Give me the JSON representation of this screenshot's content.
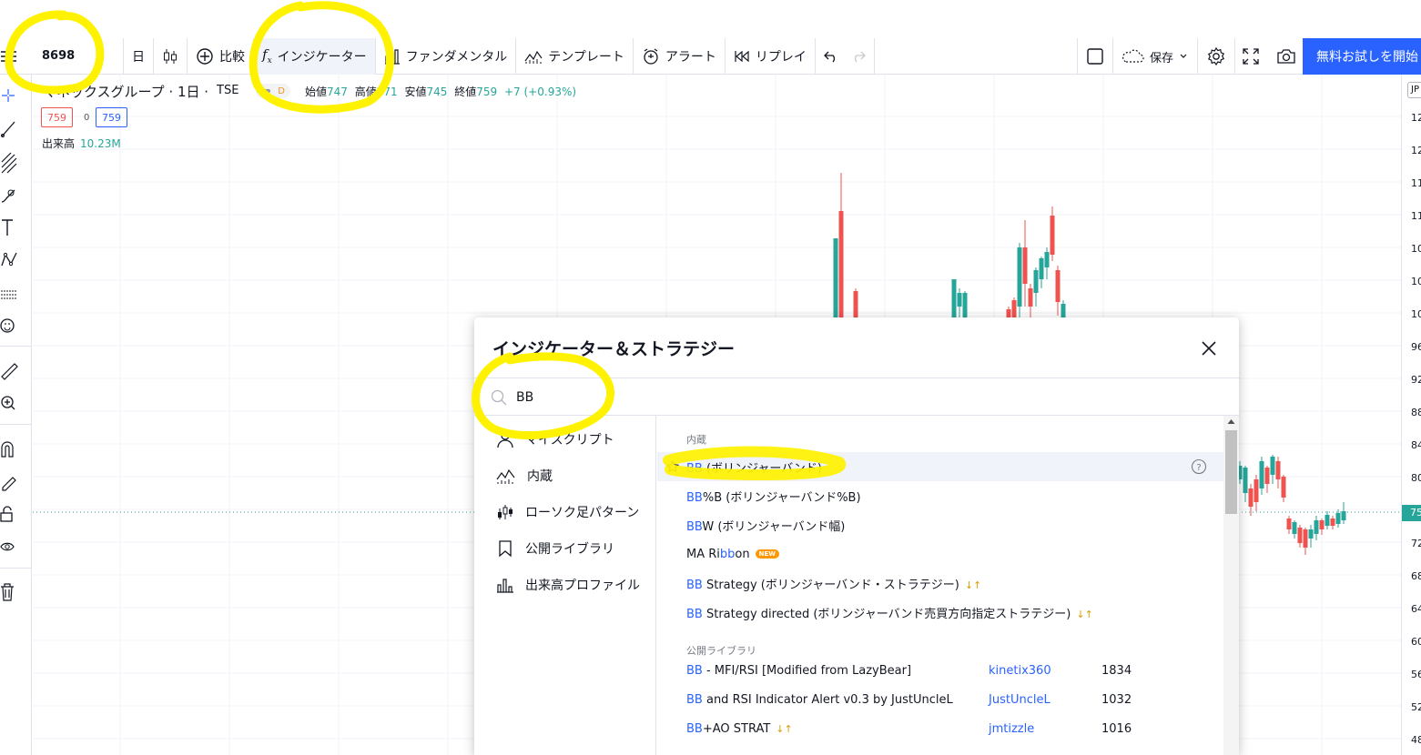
{
  "toolbar": {
    "symbol": "8698",
    "interval": "日",
    "compare_label": "比較",
    "indicators_label": "インジケーター",
    "fundamentals_label": "ファンダメンタル",
    "templates_label": "テンプレート",
    "alert_label": "アラート",
    "replay_label": "リプレイ",
    "save_label": "保存",
    "cta_label": "無料お試しを開始"
  },
  "legend": {
    "title": "マネックスグループ · 1日 ·",
    "exchange": "TSE",
    "d_badge": "D",
    "open_label": "始値",
    "open": "747",
    "high_label": "高値",
    "high": "771",
    "low_label": "安値",
    "low": "745",
    "close_label": "終値",
    "close": "759",
    "change": "+7 (+0.93%)",
    "bid": "759",
    "spread": "0",
    "ask": "759",
    "volume_label": "出来高",
    "volume": "10.23M"
  },
  "price_axis": {
    "tag": "JP",
    "labels": [
      "12",
      "12",
      "11",
      "11",
      "10",
      "10",
      "10",
      "96",
      "92",
      "88",
      "84",
      "80",
      "76",
      "72",
      "68",
      "64",
      "60",
      "56",
      "52",
      "48"
    ],
    "current": "75"
  },
  "dialog": {
    "title": "インジケーター＆ストラテジー",
    "search_value": "BB",
    "side_items": [
      {
        "label": "マイスクリプト",
        "icon": "user-icon"
      },
      {
        "label": "内蔵",
        "icon": "chart-icon"
      },
      {
        "label": "ローソク足パターン",
        "icon": "candles-icon"
      },
      {
        "label": "公開ライブラリ",
        "icon": "bookmark-icon"
      },
      {
        "label": "出来高プロファイル",
        "icon": "volume-profile-icon"
      }
    ],
    "builtin_header": "内蔵",
    "builtin": [
      {
        "hl": "BB",
        "rest": " (ボリンジャーバンド)"
      },
      {
        "hl": "BB",
        "rest": "%B (ボリンジャーバンド%B)"
      },
      {
        "hl": "BB",
        "rest": "W (ボリンジャーバンド幅)"
      },
      {
        "pre": "MA Ri",
        "hl": "bb",
        "rest": "on",
        "badge": "NEW"
      },
      {
        "hl": "BB",
        "rest": " Strategy (ボリンジャーバンド・ストラテジー)",
        "arrows": "↓↑"
      },
      {
        "hl": "BB",
        "rest": " Strategy directed (ボリンジャーバンド売買方向指定ストラテジー)",
        "arrows": "↓↑"
      }
    ],
    "public_header": "公開ライブラリ",
    "public": [
      {
        "hl": "BB",
        "rest": " - MFI/RSI [Modified from LazyBear]",
        "author": "kinetix360",
        "likes": "1834"
      },
      {
        "hl": "BB",
        "rest": " and RSI Indicator Alert v0.3 by JustUncleL",
        "author": "JustUncleL",
        "likes": "1032"
      },
      {
        "hl": "BB",
        "rest": "+AO STRAT",
        "arrows": "↓↑",
        "author": "jmtizzle",
        "likes": "1016"
      }
    ]
  },
  "colors": {
    "accent": "#2962ff",
    "up": "#26a69a",
    "down": "#ef5350",
    "marker": "#fff200"
  }
}
